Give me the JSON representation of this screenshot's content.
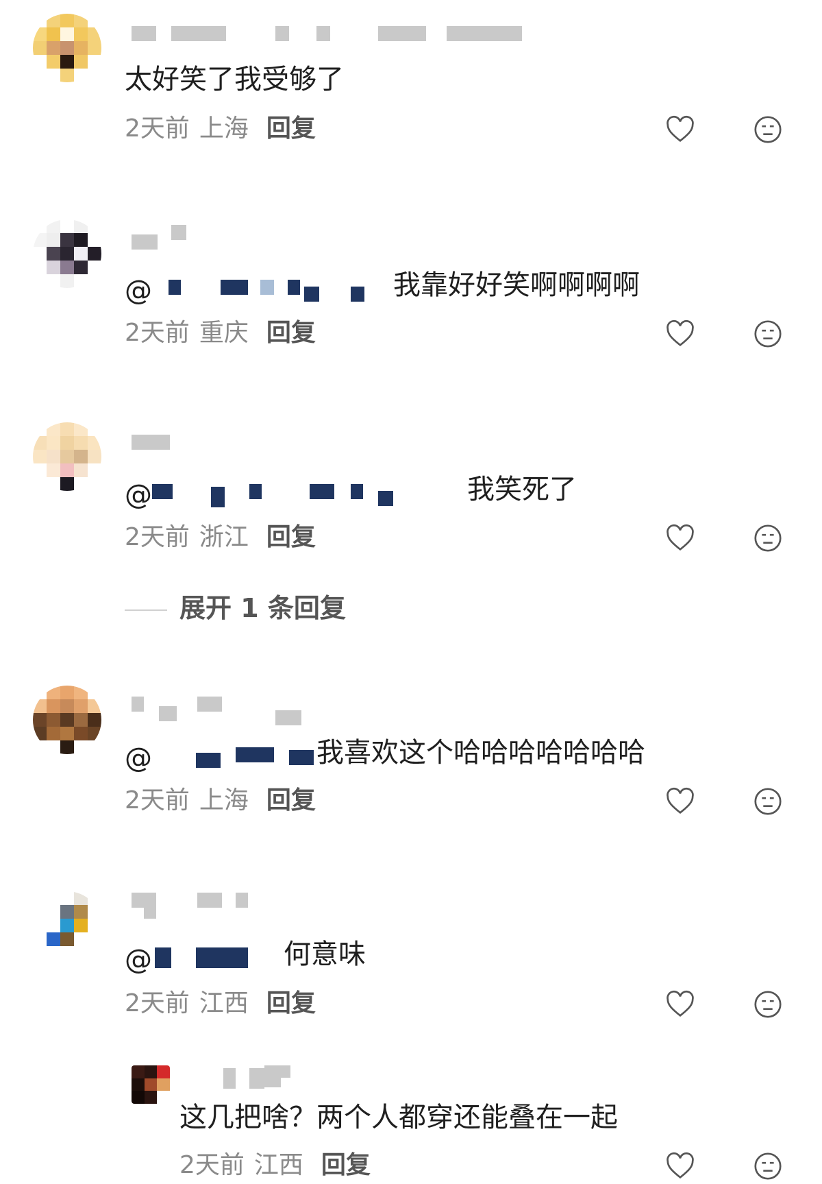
{
  "comments": [
    {
      "text": "太好笑了我受够了",
      "time": "2天前",
      "location": "上海",
      "reply": "回复"
    },
    {
      "mention": "@",
      "text": "我靠好好笑啊啊啊啊",
      "time": "2天前",
      "location": "重庆",
      "reply": "回复"
    },
    {
      "mention": "@",
      "text": "我笑死了",
      "time": "2天前",
      "location": "浙江",
      "reply": "回复"
    },
    {
      "mention": "@",
      "text": "我喜欢这个哈哈哈哈哈哈哈",
      "time": "2天前",
      "location": "上海",
      "reply": "回复"
    },
    {
      "mention": "@",
      "text": "何意味",
      "time": "2天前",
      "location": "江西",
      "reply": "回复"
    }
  ],
  "expand_replies": "展开 1 条回复",
  "sub_reply": {
    "text": "这几把啥？两个人都穿还能叠在一起",
    "time": "2天前",
    "location": "江西",
    "reply": "回复"
  },
  "icons": {
    "like": "heart-outline-icon",
    "dislike": "meh-face-icon"
  },
  "colors": {
    "meta": "#8a8a8a",
    "text": "#1f1f1f",
    "mention_redacted": "#1f3560"
  }
}
